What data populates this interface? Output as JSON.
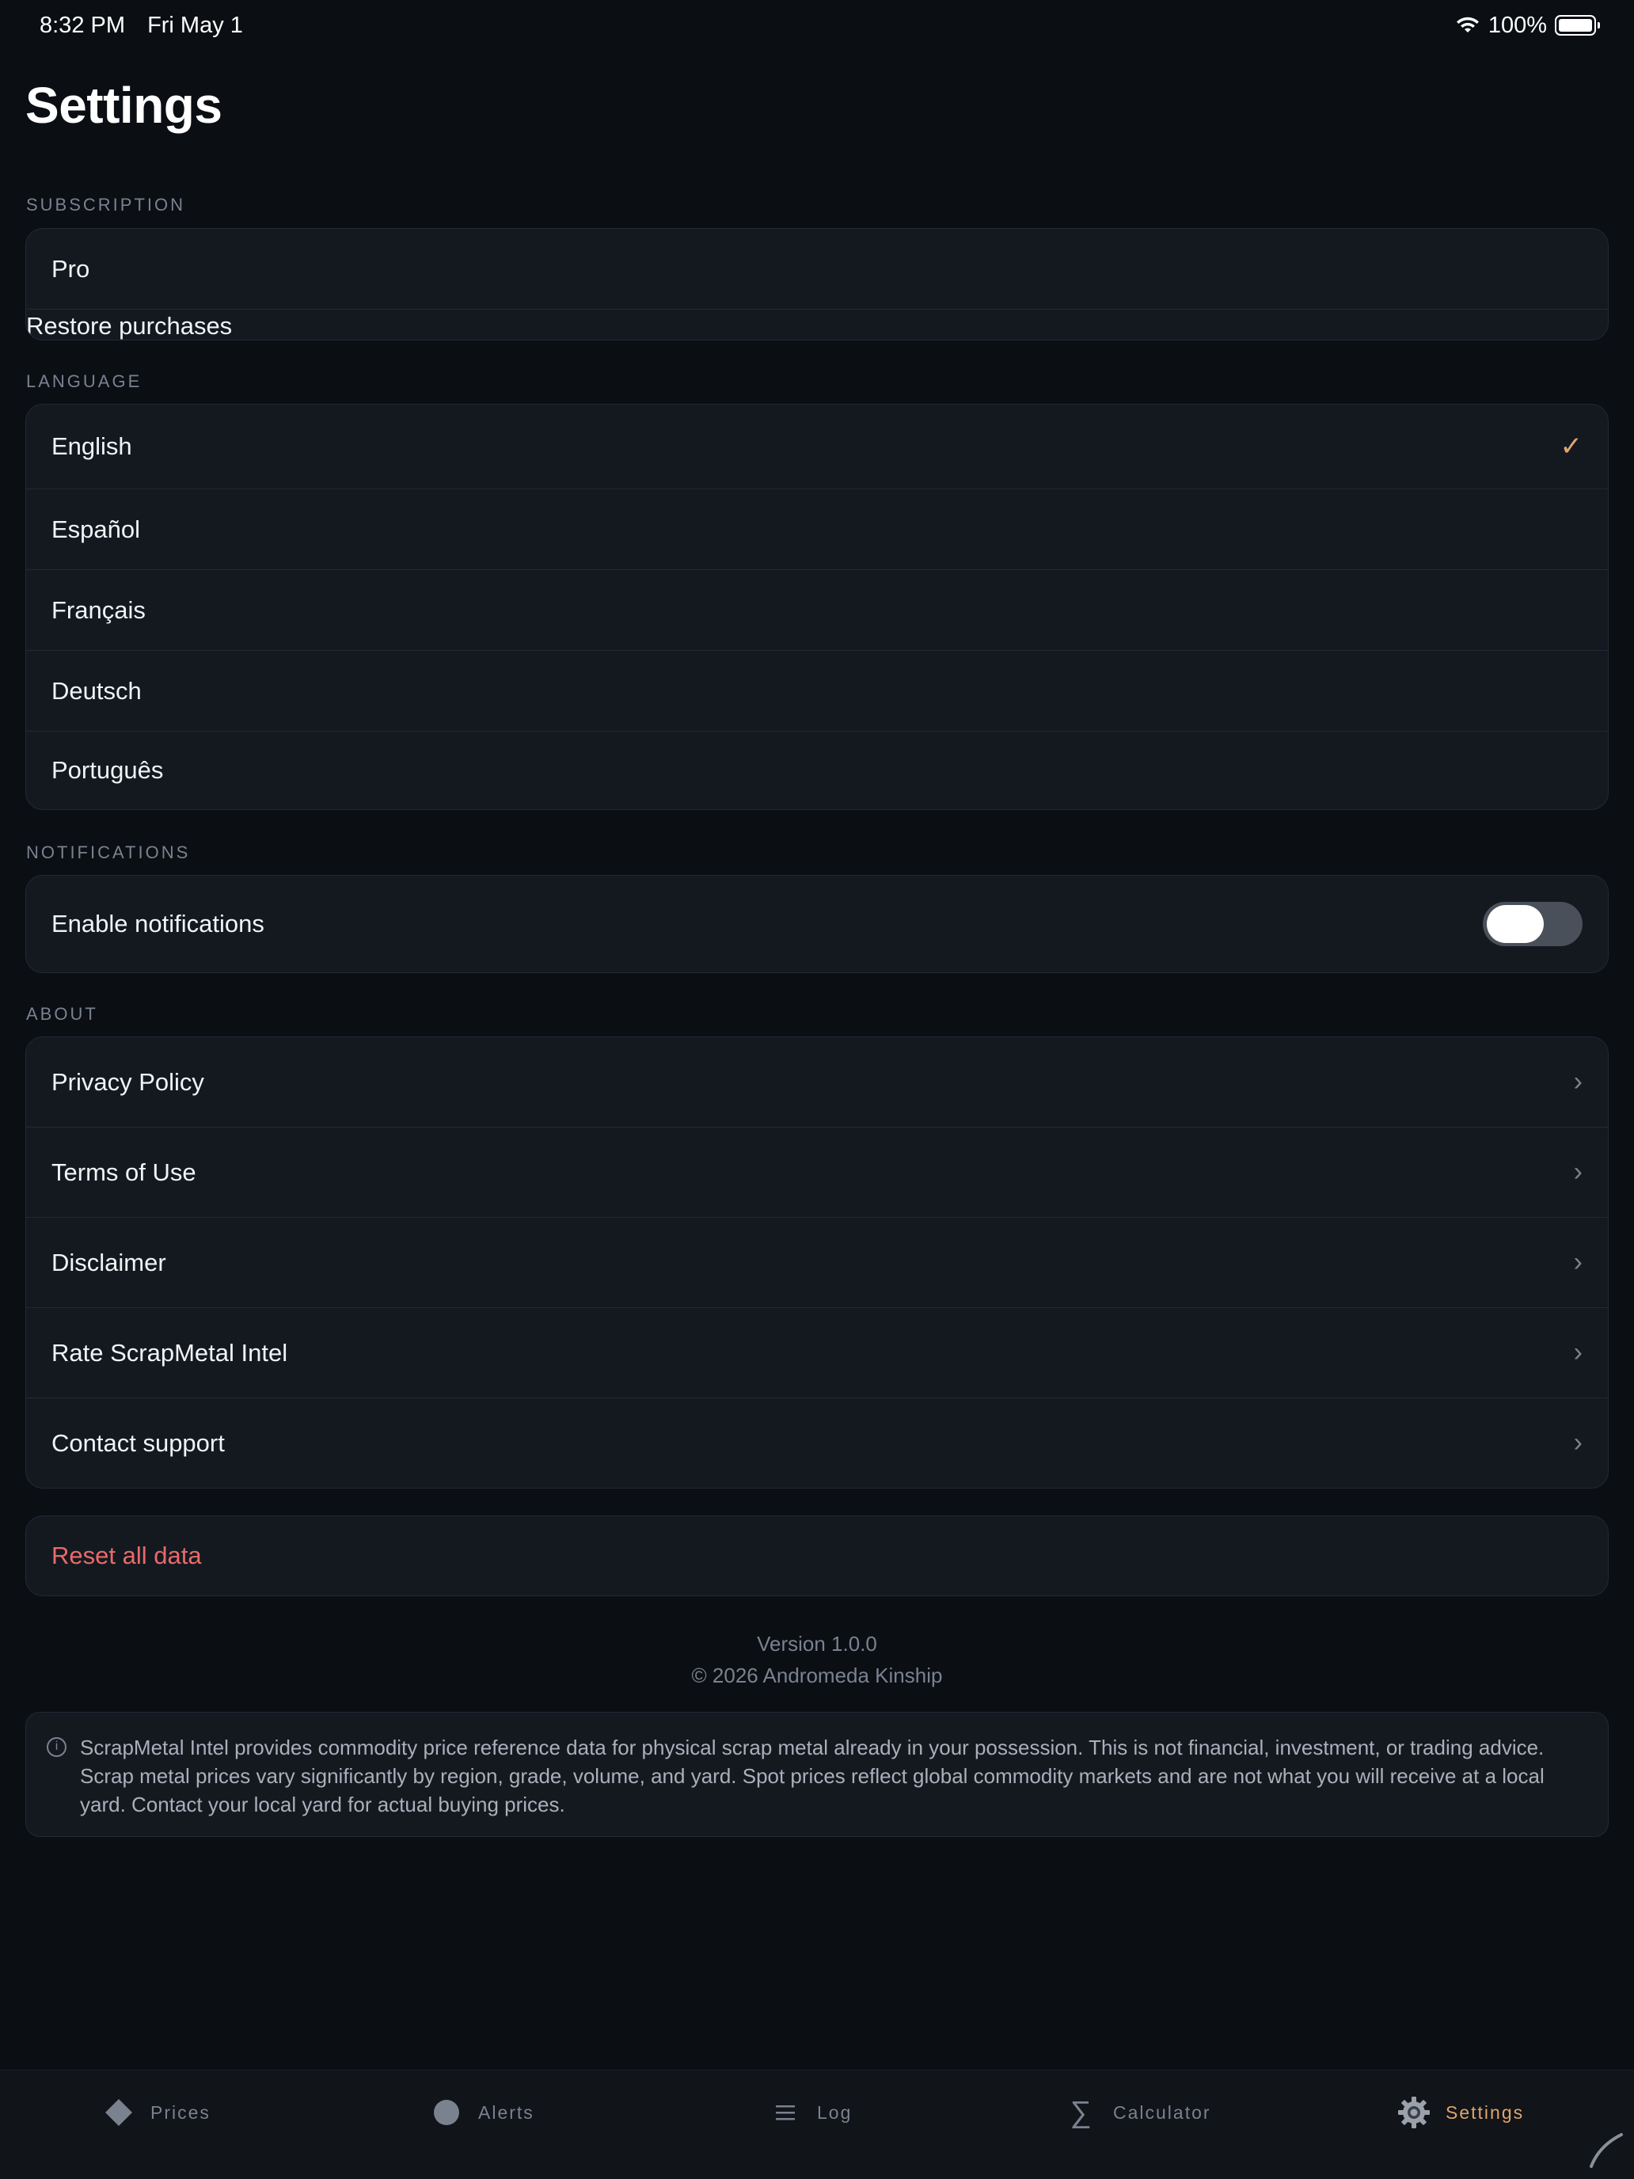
{
  "status_bar": {
    "time": "8:32 PM",
    "date": "Fri May 1",
    "battery": "100%"
  },
  "page": {
    "title": "Settings"
  },
  "subscription": {
    "header": "SUBSCRIPTION",
    "plan": "Pro",
    "restore": "Restore purchases"
  },
  "language": {
    "header": "LANGUAGE",
    "options": [
      "English",
      "Español",
      "Français",
      "Deutsch",
      "Português"
    ],
    "selected": "English"
  },
  "notifications": {
    "header": "NOTIFICATIONS",
    "label": "Enable notifications",
    "enabled": false
  },
  "about": {
    "header": "ABOUT",
    "items": [
      "Privacy Policy",
      "Terms of Use",
      "Disclaimer",
      "Rate ScrapMetal Intel",
      "Contact support"
    ]
  },
  "reset": {
    "label": "Reset all data"
  },
  "footer": {
    "version": "Version 1.0.0",
    "copyright": "© 2026 Andromeda Kinship"
  },
  "disclaimer": {
    "text": "ScrapMetal Intel provides commodity price reference data for physical scrap metal already in your possession. This is not financial, investment, or trading advice. Scrap metal prices vary significantly by region, grade, volume, and yard. Spot prices reflect global commodity markets and are not what you will receive at a local yard. Contact your local yard for actual buying prices."
  },
  "tabs": [
    {
      "label": "Prices",
      "icon": "diamond-icon"
    },
    {
      "label": "Alerts",
      "icon": "circle-icon"
    },
    {
      "label": "Log",
      "icon": "list-icon"
    },
    {
      "label": "Calculator",
      "icon": "sigma-icon"
    },
    {
      "label": "Settings",
      "icon": "gear-icon",
      "active": true
    }
  ],
  "colors": {
    "accent": "#e0a56c",
    "danger": "#e96a6a",
    "background": "#0b0e13",
    "card": "#141920"
  }
}
